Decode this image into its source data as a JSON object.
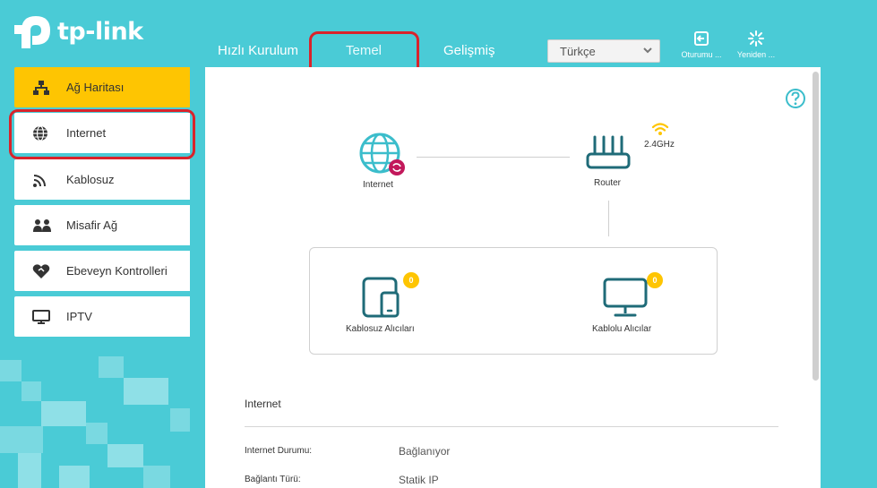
{
  "brand": {
    "name": "tp-link"
  },
  "nav": {
    "tabs": [
      {
        "label": "Hızlı Kurulum"
      },
      {
        "label": "Temel"
      },
      {
        "label": "Gelişmiş"
      }
    ],
    "language": "Türkçe",
    "logout_label": "Oturumu ...",
    "reboot_label": "Yeniden ..."
  },
  "sidebar": {
    "items": [
      {
        "label": "Ağ Haritası",
        "icon": "network-map-icon",
        "active": true
      },
      {
        "label": "Internet",
        "icon": "globe-icon"
      },
      {
        "label": "Kablosuz",
        "icon": "wireless-icon"
      },
      {
        "label": "Misafir Ağ",
        "icon": "guest-icon"
      },
      {
        "label": "Ebeveyn Kontrolleri",
        "icon": "heart-icon"
      },
      {
        "label": "IPTV",
        "icon": "tv-icon"
      }
    ]
  },
  "diagram": {
    "internet_label": "Internet",
    "router_label": "Router",
    "band_label": "2.4GHz",
    "wireless_clients_label": "Kablosuz Alıcıları",
    "wireless_clients_count": "0",
    "wired_clients_label": "Kablolu Alıcılar",
    "wired_clients_count": "0"
  },
  "internet_section": {
    "title": "Internet",
    "rows": [
      {
        "key": "Internet Durumu:",
        "value": "Bağlanıyor"
      },
      {
        "key": "Bağlantı Türü:",
        "value": "Statik IP"
      }
    ]
  },
  "colors": {
    "background": "#4acbd6",
    "accent": "#fec502",
    "highlight_outline": "#d9232b",
    "icon_teal": "#1f6b78"
  }
}
